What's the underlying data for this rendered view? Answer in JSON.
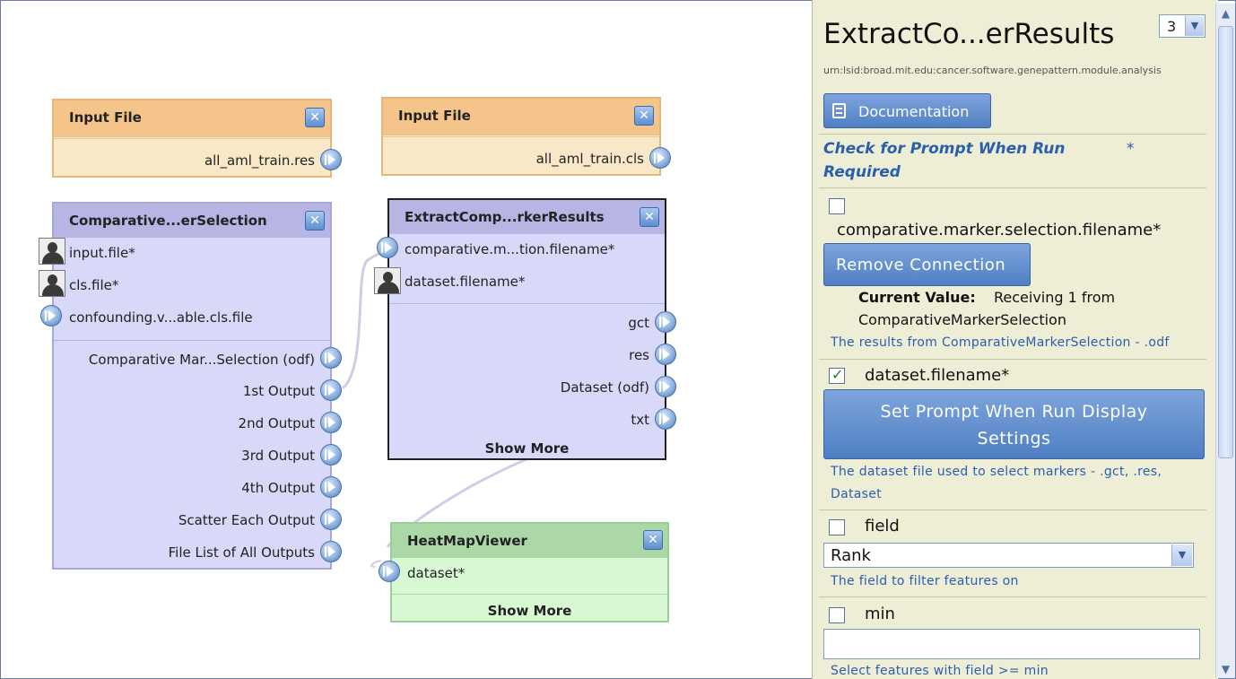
{
  "canvas": {
    "modules": {
      "input_file_1": {
        "title": "Input File",
        "output": "all_aml_train.res"
      },
      "input_file_2": {
        "title": "Input File",
        "output": "all_aml_train.cls"
      },
      "cms": {
        "title": "Comparative...erSelection",
        "inputs": [
          "input.file*",
          "cls.file*",
          "confounding.v...able.cls.file"
        ],
        "outputs": [
          "Comparative Mar...Selection (odf)",
          "1st Output",
          "2nd Output",
          "3rd Output",
          "4th Output",
          "Scatter Each Output",
          "File List of All Outputs"
        ]
      },
      "emr": {
        "title": "ExtractComp...rkerResults",
        "inputs": [
          "comparative.m...tion.filename*",
          "dataset.filename*"
        ],
        "outputs": [
          "gct",
          "res",
          "Dataset (odf)",
          "txt"
        ],
        "show_more": "Show More"
      },
      "heatmap": {
        "title": "HeatMapViewer",
        "inputs": [
          "dataset*"
        ],
        "show_more": "Show More"
      }
    },
    "colors": {
      "input_head": "#f4c48a",
      "input_body": "#f8e8c8",
      "purple_head": "#b7b5e4",
      "purple_body": "#d8d8f8",
      "green_head": "#acd8a8",
      "green_body": "#d8f8d4"
    }
  },
  "panel": {
    "title": "ExtractCo...erResults",
    "version_select": "3",
    "urn": "urn:lsid:broad.mit.edu:cancer.software.genepattern.module.analysis",
    "documentation_btn": "Documentation",
    "check_prompt": "Check for Prompt When Run",
    "required_star": "*",
    "required": "Required",
    "param1": {
      "name": "comparative.marker.selection.filename*",
      "remove_btn": "Remove Connection",
      "current_label": "Current Value:",
      "current_value": "Receiving 1 from",
      "current_value2": "ComparativeMarkerSelection",
      "hint": "The results from ComparativeMarkerSelection - .odf",
      "checked": false
    },
    "param2": {
      "name": "dataset.filename*",
      "set_prompt_btn_line1": "Set Prompt When Run Display",
      "set_prompt_btn_line2": "Settings",
      "hint_line1": "The dataset file used to select markers - .gct, .res,",
      "hint_line2": "Dataset",
      "checked": true
    },
    "param3": {
      "name": "field",
      "value": "Rank",
      "hint": "The field to filter features on",
      "checked": false
    },
    "param4": {
      "name": "min",
      "value": "",
      "hint": "Select features with field >= min",
      "checked": false
    }
  }
}
